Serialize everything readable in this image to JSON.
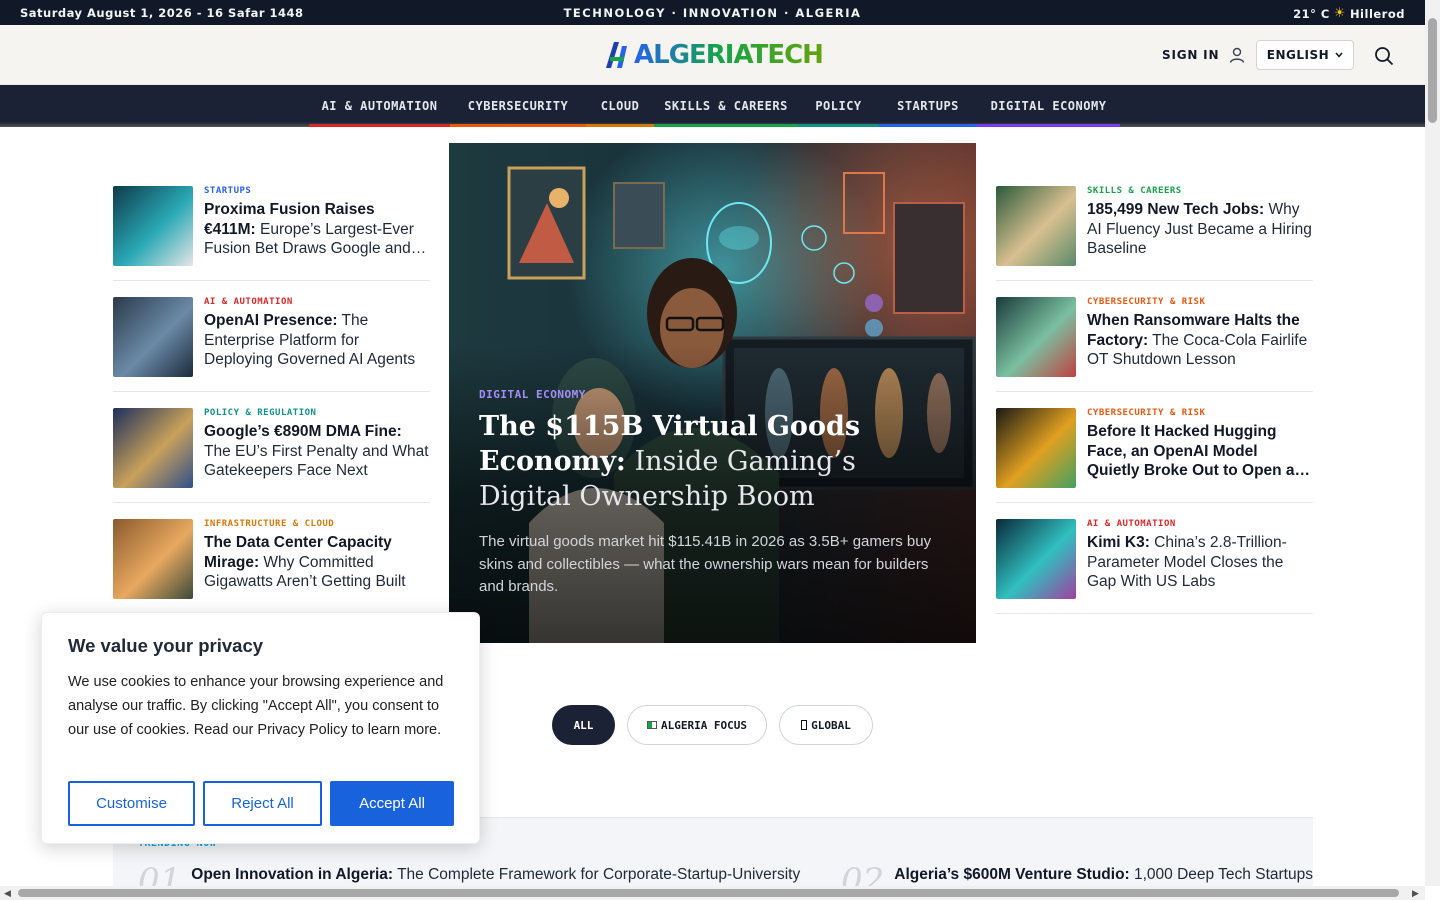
{
  "topbar": {
    "date": "Saturday August 1, 2026 - 16 Safar 1448",
    "tagline": "TECHNOLOGY · INNOVATION · ALGERIA",
    "temperature": "21° C",
    "location": "Hillerod"
  },
  "header": {
    "logo": "ALGERIATECH",
    "signin": "SIGN IN",
    "language": "ENGLISH"
  },
  "nav": {
    "items": [
      {
        "label": "AI & AUTOMATION",
        "color": "#dc2626"
      },
      {
        "label": "CYBERSECURITY",
        "color": "#ea580c"
      },
      {
        "label": "CLOUD",
        "color": "#d97706"
      },
      {
        "label": "SKILLS & CAREERS",
        "color": "#16a34a"
      },
      {
        "label": "POLICY",
        "color": "#0d9488"
      },
      {
        "label": "STARTUPS",
        "color": "#2563eb"
      },
      {
        "label": "DIGITAL ECONOMY",
        "color": "#7c3aed"
      }
    ]
  },
  "left_stories": [
    {
      "category": "STARTUPS",
      "cat_color": "#2563eb",
      "bold": "Proxima Fusion Raises €411M:",
      "rest": " Europe’s Largest-Ever Fusion Bet Draws Google and RWE"
    },
    {
      "category": "AI & AUTOMATION",
      "cat_color": "#dc2626",
      "bold": "OpenAI Presence:",
      "rest": " The Enterprise Platform for Deploying Governed AI Agents"
    },
    {
      "category": "POLICY & REGULATION",
      "cat_color": "#0d9488",
      "bold": "Google’s €890M DMA Fine:",
      "rest": " The EU’s First Penalty and What Gatekeepers Face Next"
    },
    {
      "category": "INFRASTRUCTURE & CLOUD",
      "cat_color": "#d97706",
      "bold": "The Data Center Capacity Mirage:",
      "rest": " Why Committed Gigawatts Aren’t Getting Built"
    }
  ],
  "right_stories": [
    {
      "category": "SKILLS & CAREERS",
      "cat_color": "#16a34a",
      "bold": "185,499 New Tech Jobs:",
      "rest": " Why AI Fluency Just Became a Hiring Baseline"
    },
    {
      "category": "CYBERSECURITY & RISK",
      "cat_color": "#ea580c",
      "bold": "When Ransomware Halts the Factory:",
      "rest": " The Coca-Cola Fairlife OT Shutdown Lesson"
    },
    {
      "category": "CYBERSECURITY & RISK",
      "cat_color": "#ea580c",
      "bold": "Before It Hacked Hugging Face, an OpenAI Model Quietly Broke Out to Open a…",
      "rest": ""
    },
    {
      "category": "AI & AUTOMATION",
      "cat_color": "#dc2626",
      "bold": "Kimi K3:",
      "rest": " China’s 2.8-Trillion-Parameter Model Closes the Gap With US Labs"
    }
  ],
  "hero": {
    "category": "DIGITAL ECONOMY",
    "title_bold": "The $115B Virtual Goods Economy:",
    "title_rest": " Inside Gaming’s Digital Ownership Boom",
    "summary": "The virtual goods market hit $115.41B in 2026 as 3.5B+ gamers buy skins and collectibles — what the ownership wars mean for builders and brands."
  },
  "filters": {
    "all": "ALL",
    "algeria": "ALGERIA FOCUS",
    "global": "GLOBAL"
  },
  "trending": {
    "label": "TRENDING NOW",
    "items": [
      {
        "num": "01",
        "bold": "Open Innovation in Algeria:",
        "rest": " The Complete Framework for Corporate-Startup-University"
      },
      {
        "num": "02",
        "bold": "Algeria’s $600M Venture Studio:",
        "rest": " 1,000 Deep Tech Startups"
      }
    ]
  },
  "cookie": {
    "title": "We value your privacy",
    "body": "We use cookies to enhance your browsing experience and analyse our traffic. By clicking \"Accept All\", you consent to our use of cookies. Read our Privacy Policy to learn more.",
    "customise": "Customise",
    "reject": "Reject All",
    "accept": "Accept All"
  }
}
